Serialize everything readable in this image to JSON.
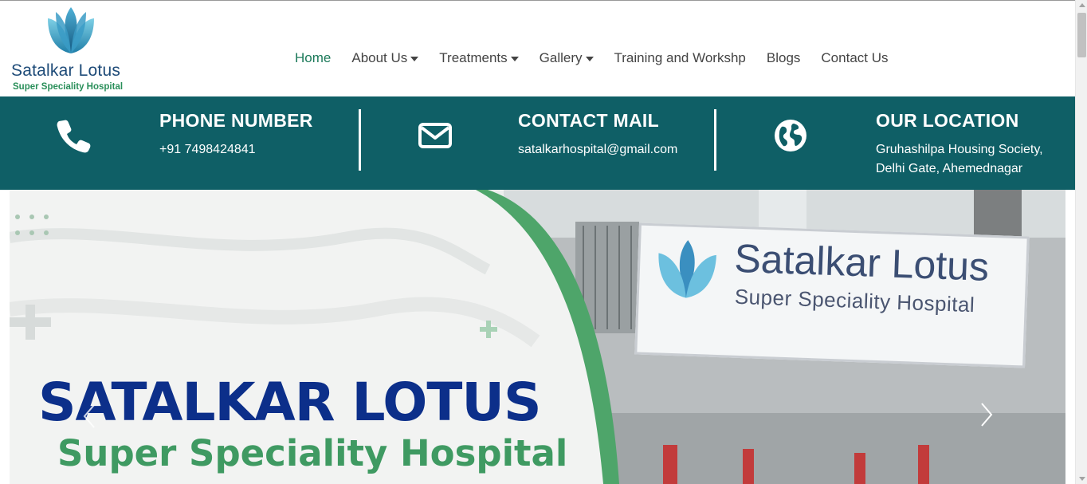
{
  "logo": {
    "name": "Satalkar Lotus",
    "subtitle": "Super Speciality Hospital"
  },
  "nav": {
    "items": [
      {
        "label": "Home",
        "active": true,
        "dropdown": false
      },
      {
        "label": "About Us",
        "active": false,
        "dropdown": true
      },
      {
        "label": "Treatments",
        "active": false,
        "dropdown": true
      },
      {
        "label": "Gallery",
        "active": false,
        "dropdown": true
      },
      {
        "label": "Training and Workshp",
        "active": false,
        "dropdown": false
      },
      {
        "label": "Blogs",
        "active": false,
        "dropdown": false
      },
      {
        "label": "Contact Us",
        "active": false,
        "dropdown": false
      }
    ]
  },
  "contact_bar": {
    "phone": {
      "title": "PHONE NUMBER",
      "value": "+91 7498424841",
      "icon": "phone-icon"
    },
    "mail": {
      "title": "CONTACT MAIL",
      "value": "satalkarhospital@gmail.com",
      "icon": "envelope-icon"
    },
    "location": {
      "title": "OUR LOCATION",
      "line1": "Gruhashilpa Housing Society,",
      "line2": "Delhi Gate, Ahemednagar",
      "icon": "globe-icon"
    }
  },
  "hero": {
    "title": "SATALKAR LOTUS",
    "subtitle": "Super Speciality Hospital",
    "sign_name": "Satalkar Lotus",
    "sign_subtitle": "Super Speciality Hospital"
  },
  "colors": {
    "bar_bg": "#0f5f66",
    "nav_active": "#1c7a5a",
    "hero_title": "#0c2f8a",
    "hero_sub": "#3f9a62"
  }
}
